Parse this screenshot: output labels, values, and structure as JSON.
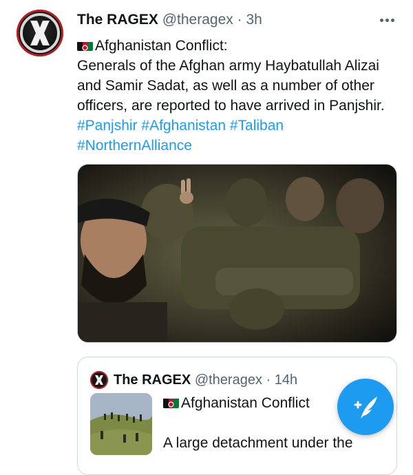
{
  "tweet": {
    "author_name": "The RAGEX",
    "handle": "@theragex",
    "separator": "·",
    "time": "3h",
    "avatar_icon": "ragex-x-logo",
    "more_icon": "more-dots-icon",
    "flag_icon": "afghanistan-flag-icon",
    "topic": "Afghanistan Conflict:",
    "body_lines": [
      "Generals of the Afghan army Haybatullah Alizai",
      "and Samir Sadat, as well as a number of other",
      "officers, are reported to have arrived in Panjshir."
    ],
    "hashtags": [
      "#Panjshir",
      "#Afghanistan",
      "#Taliban",
      "#NorthernAlliance"
    ],
    "photo_description_icon": "soldiers-photo"
  },
  "quoted_tweet": {
    "author_name": "The RAGEX",
    "handle": "@theragex",
    "separator": "·",
    "time": "14h",
    "topic": "Afghanistan Conflict",
    "text_start": "A large detachment under the"
  },
  "fab": {
    "icon": "compose-tweet-icon"
  },
  "colors": {
    "link": "#1d9bf0",
    "text": "#0f1419",
    "secondary": "#536471",
    "border": "#cfd9de",
    "brand_red": "#b51e22"
  }
}
